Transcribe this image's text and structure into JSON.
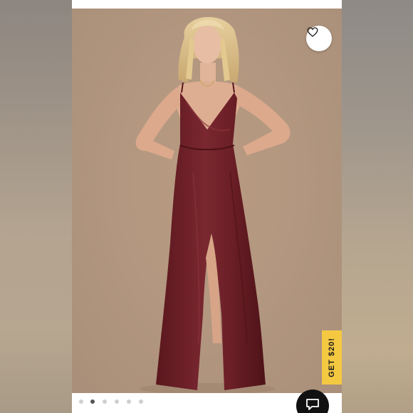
{
  "product_gallery": {
    "favorite_icon": "heart-outline-icon",
    "promo_label": "GET $20!",
    "carousel": {
      "total": 6,
      "active_index": 1
    },
    "chat_icon": "chat-bubble-icon"
  },
  "colors": {
    "backdrop": "#b39780",
    "dress": "#6e1f26",
    "promo": "#f5c842",
    "chat": "#111111"
  }
}
